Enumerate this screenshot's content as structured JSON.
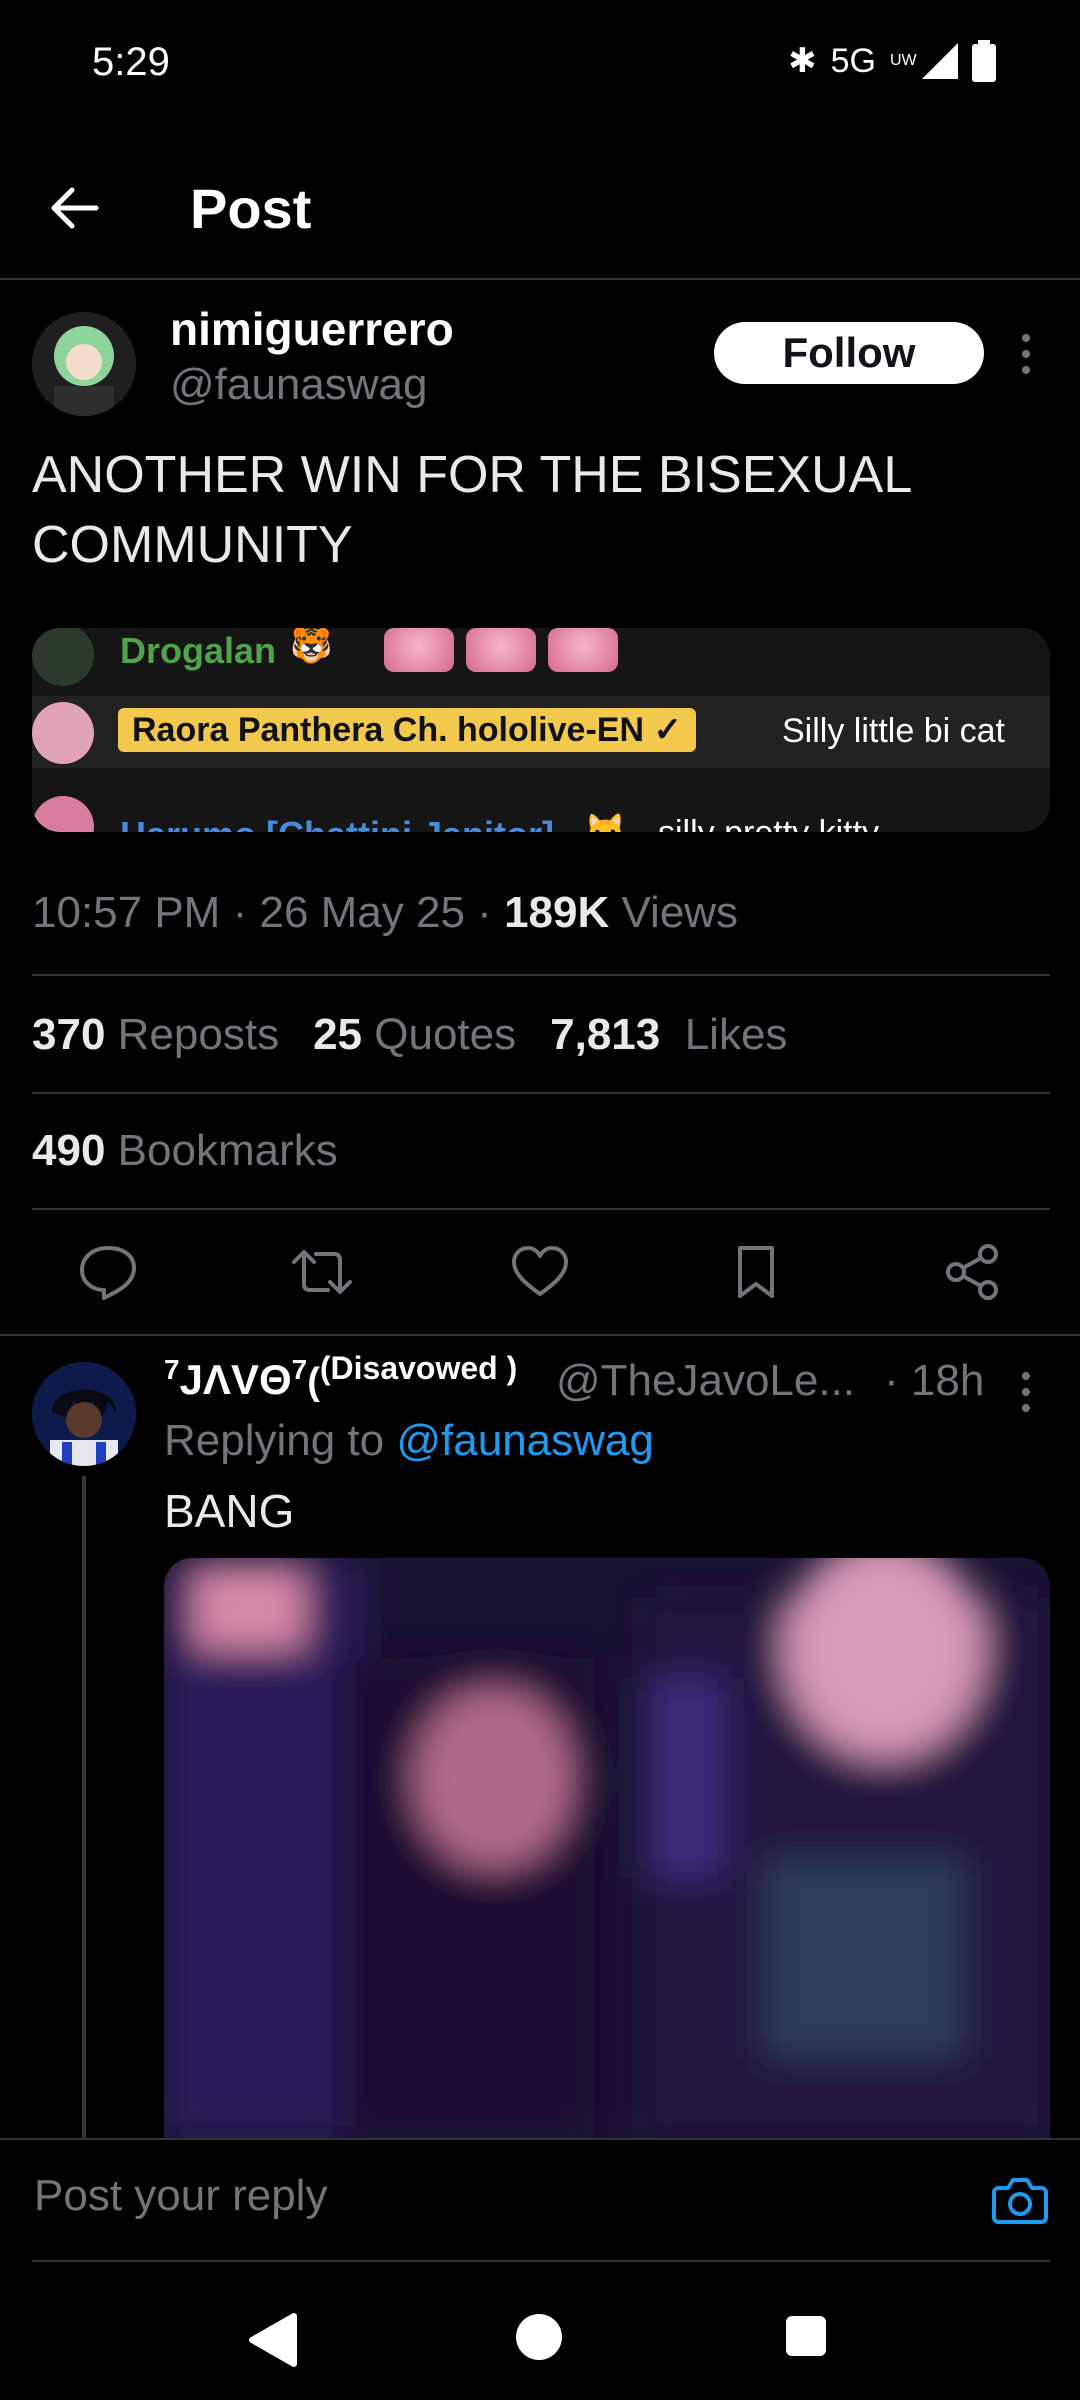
{
  "status_bar": {
    "time": "5:29",
    "network": "5G",
    "network_sub": "UW"
  },
  "header": {
    "title": "Post"
  },
  "post": {
    "author_name": "nimiguerrero",
    "author_handle": "@faunaswag",
    "follow_label": "Follow",
    "text": "ANOTHER WIN FOR THE BISEXUAL COMMUNITY",
    "media": {
      "rows": [
        {
          "name": "Drogalan",
          "emoji": "🐯",
          "message": ""
        },
        {
          "name": "Raora Panthera Ch. hololive-EN",
          "verified": "✓",
          "message": "Silly little bi cat"
        },
        {
          "name": "Harumo [Chattini Janitor]",
          "emoji": "🐱",
          "message": "silly pretty kitty"
        }
      ]
    },
    "time": "10:57 PM",
    "date": "26 May 25",
    "views_count": "189K",
    "views_label": "Views",
    "reposts_count": "370",
    "reposts_label": "Reposts",
    "quotes_count": "25",
    "quotes_label": "Quotes",
    "likes_count": "7,813",
    "likes_label": "Likes",
    "bookmarks_count": "490",
    "bookmarks_label": "Bookmarks"
  },
  "reply": {
    "name_prefix": "7",
    "name_main": "JΛVΘ",
    "name_mid": "7",
    "name_suffix": "(Disavowed )",
    "handle": "@TheJavoLe...",
    "time": "· 18h",
    "replying_prefix": "Replying to",
    "replying_handle": "@faunaswag",
    "text": "BANG"
  },
  "compose": {
    "placeholder": "Post your reply"
  },
  "colors": {
    "accent": "#1d9bf0",
    "muted": "#71767b",
    "badge": "#f2c94c"
  }
}
